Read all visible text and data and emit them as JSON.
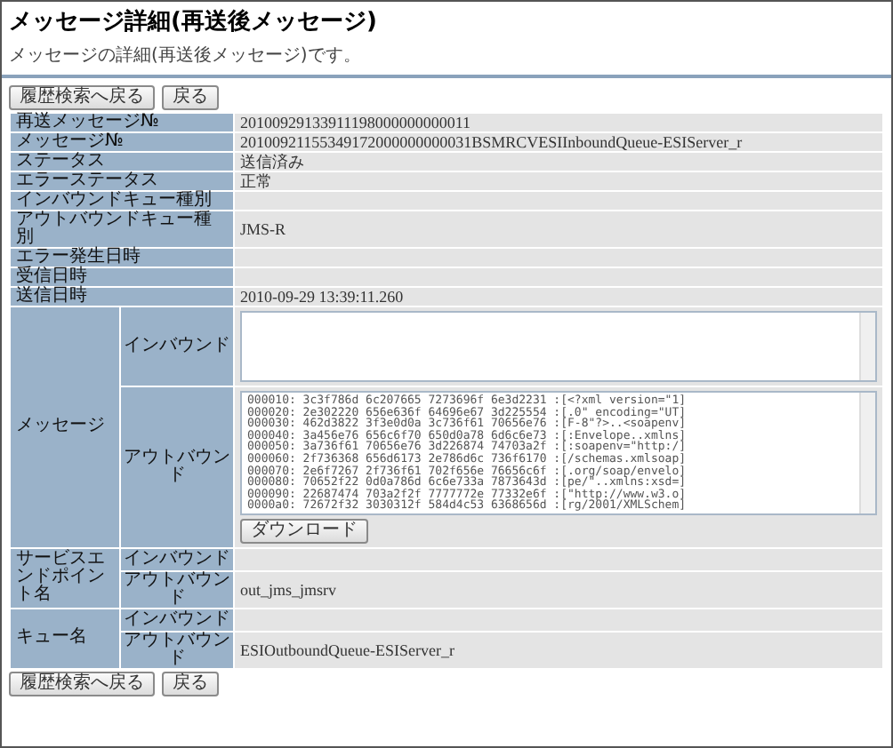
{
  "page": {
    "title": "メッセージ詳細(再送後メッセージ)",
    "description": "メッセージの詳細(再送後メッセージ)です。"
  },
  "top_buttons": [
    "履歴検索へ戻る",
    "戻る"
  ],
  "fields": [
    {
      "label": "再送メッセージ№",
      "value": "20100929133911198000000000011"
    },
    {
      "label": "メッセージ№",
      "value": "20100921155349172000000000031BSMRCVESIInboundQueue-ESIServer_r"
    },
    {
      "label": "ステータス",
      "value": "送信済み"
    },
    {
      "label": "エラーステータス",
      "value": "正常"
    },
    {
      "label": "インバウンドキュー種別"
    },
    {
      "label": "アウトバウンドキュー種別",
      "value": "JMS-R"
    },
    {
      "label": "エラー発生日時"
    },
    {
      "label": "受信日時"
    },
    {
      "label": "送信日時",
      "value": "2010-09-29 13:39:11.260"
    }
  ],
  "message": {
    "label": "メッセージ",
    "inbound": {
      "label": "インバウンド"
    },
    "outbound": {
      "label": "アウトバウンド",
      "lines": [
        "000010: 3c3f786d 6c207665 7273696f 6e3d2231 :[<?xml version=\"1]",
        "000020: 2e302220 656e636f 64696e67 3d225554 :[.0\" encoding=\"UT]",
        "000030: 462d3822 3f3e0d0a 3c736f61 70656e76 :[F-8\"?>..<soapenv]",
        "000040: 3a456e76 656c6f70 650d0a78 6d6c6e73 :[:Envelope..xmlns]",
        "000050: 3a736f61 70656e76 3d226874 74703a2f :[:soapenv=\"http:/]",
        "000060: 2f736368 656d6173 2e786d6c 736f6170 :[/schemas.xmlsoap]",
        "000070: 2e6f7267 2f736f61 702f656e 76656c6f :[.org/soap/envelo]",
        "000080: 70652f22 0d0a786d 6c6e733a 7873643d :[pe/\"..xmlns:xsd=]",
        "000090: 22687474 703a2f2f 7777772e 77332e6f :[\"http://www.w3.o]",
        "0000a0: 72672f32 3030312f 584d4c53 6368656d :[rg/2001/XMLSchem]"
      ]
    },
    "download_button": "ダウンロード"
  },
  "groups": [
    {
      "label": "サービスエンドポイント名",
      "rows": [
        {
          "label": "インバウンド"
        },
        {
          "label": "アウトバウンド",
          "value": "out_jms_jmsrv"
        }
      ]
    },
    {
      "label": "キュー名",
      "rows": [
        {
          "label": "インバウンド"
        },
        {
          "label": "アウトバウンド",
          "value": "ESIOutboundQueue-ESIServer_r"
        }
      ]
    }
  ],
  "bottom_buttons": [
    "履歴検索へ戻る",
    "戻る"
  ]
}
